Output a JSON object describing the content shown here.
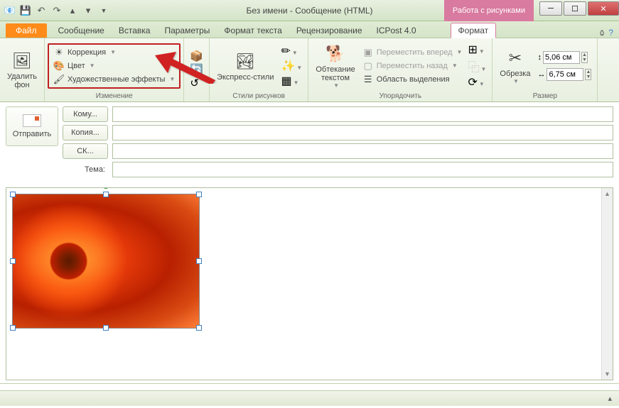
{
  "title": "Без имени  -  Сообщение (HTML)",
  "contextual_title": "Работа с рисунками",
  "tabs": {
    "file": "Файл",
    "message": "Сообщение",
    "insert": "Вставка",
    "options": "Параметры",
    "format_text": "Формат текста",
    "review": "Рецензирование",
    "icpost": "ICPost 4.0",
    "format": "Формат"
  },
  "ribbon": {
    "remove_bg": "Удалить\nфон",
    "corrections": "Коррекция",
    "color": "Цвет",
    "artistic": "Художественные эффекты",
    "group_adjust": "Изменение",
    "express_styles": "Экспресс-стили",
    "group_styles": "Стили рисунков",
    "wrap_text": "Обтекание\nтекстом",
    "bring_forward": "Переместить вперед",
    "send_backward": "Переместить назад",
    "selection_pane": "Область выделения",
    "group_arrange": "Упорядочить",
    "crop": "Обрезка",
    "height_value": "5,06 см",
    "width_value": "6,75 см",
    "group_size": "Размер"
  },
  "header": {
    "send": "Отправить",
    "to": "Кому...",
    "cc": "Копия...",
    "bcc": "СК...",
    "subject": "Тема:"
  }
}
